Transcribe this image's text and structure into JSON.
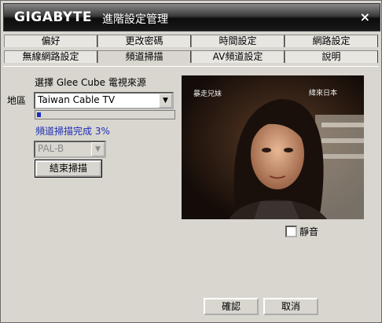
{
  "window": {
    "brand": "GIGABYTE",
    "title": "進階設定管理",
    "close": "×"
  },
  "tabs": {
    "row1": [
      "偏好",
      "更改密碼",
      "時間設定",
      "網路設定"
    ],
    "row2": [
      "無線網路設定",
      "頻道掃描",
      "AV頻道設定",
      "說明"
    ],
    "active": "頻道掃描"
  },
  "scan": {
    "source_prompt": "選擇 Glee Cube 電視來源",
    "region_label": "地區",
    "region_value": "Taiwan Cable TV",
    "progress_percent": 3,
    "status_text": "頻道掃描完成 3%",
    "format_value": "PAL-B",
    "stop_button": "結束掃描"
  },
  "preview": {
    "overlay_left": "暴走兄妹",
    "overlay_right": "緯來日本",
    "mute_label": "靜音",
    "mute_checked": false
  },
  "footer": {
    "ok_button": "確認",
    "cancel_button": "取消"
  }
}
